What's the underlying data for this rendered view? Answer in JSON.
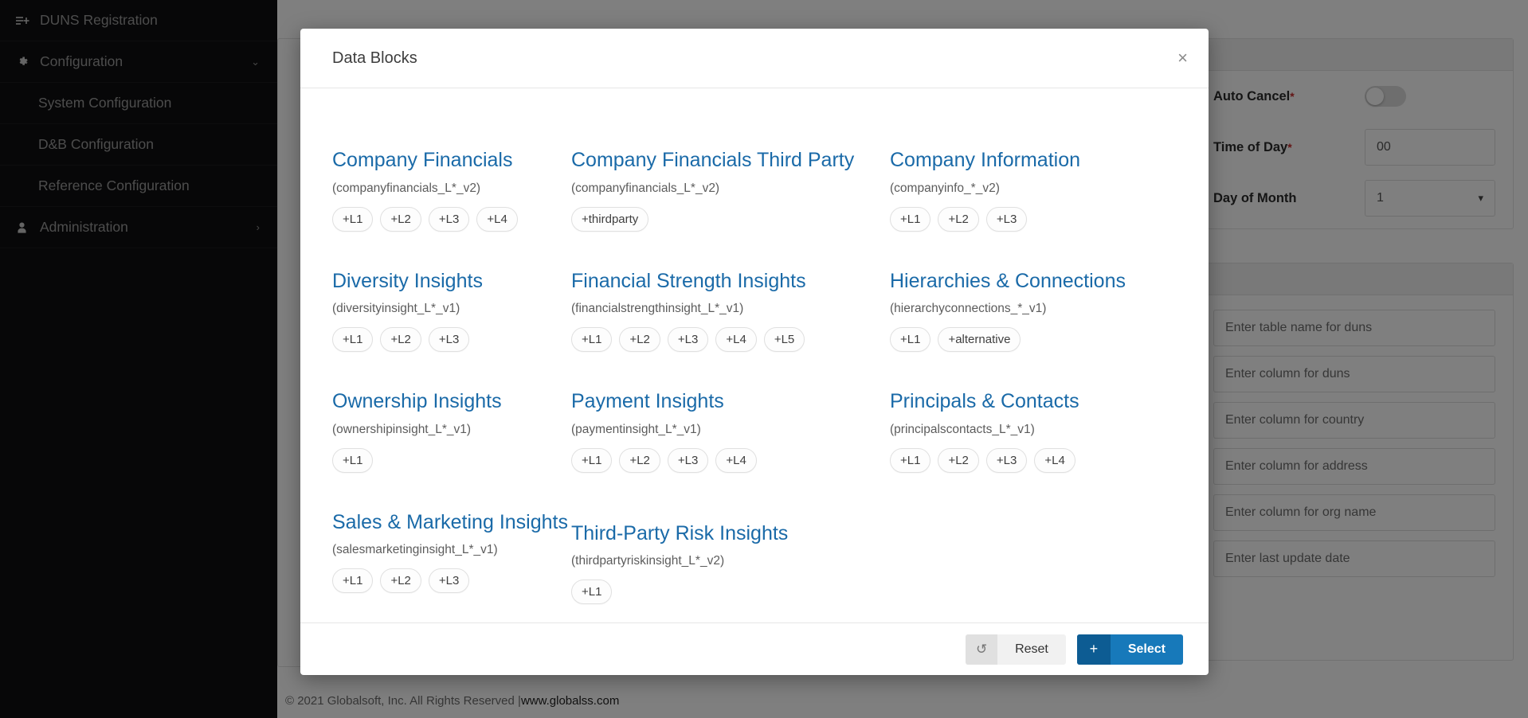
{
  "sidebar": {
    "items": [
      {
        "label": "DUNS Registration",
        "icon": "list-add-icon",
        "kind": "top",
        "chevron": ""
      },
      {
        "label": "Configuration",
        "icon": "gear-icon",
        "kind": "top",
        "chevron": "⌄"
      },
      {
        "label": "System Configuration",
        "icon": "",
        "kind": "sub",
        "chevron": ""
      },
      {
        "label": "D&B Configuration",
        "icon": "",
        "kind": "sub",
        "chevron": ""
      },
      {
        "label": "Reference Configuration",
        "icon": "",
        "kind": "sub",
        "chevron": ""
      },
      {
        "label": "Administration",
        "icon": "user-icon",
        "kind": "top",
        "chevron": "›"
      }
    ]
  },
  "modal": {
    "title": "Data Blocks",
    "close_label": "×",
    "blocks": [
      {
        "name": "Company Financials",
        "code": "(companyfinancials_L*_v2)",
        "chips": [
          "+L1",
          "+L2",
          "+L3",
          "+L4"
        ]
      },
      {
        "name": "Company Financials Third Party",
        "code": "(companyfinancials_L*_v2)",
        "chips": [
          "+thirdparty"
        ]
      },
      {
        "name": "Company Information",
        "code": "(companyinfo_*_v2)",
        "chips": [
          "+L1",
          "+L2",
          "+L3"
        ]
      },
      {
        "name": "Diversity Insights",
        "code": "(diversityinsight_L*_v1)",
        "chips": [
          "+L1",
          "+L2",
          "+L3"
        ]
      },
      {
        "name": "Financial Strength Insights",
        "code": "(financialstrengthinsight_L*_v1)",
        "chips": [
          "+L1",
          "+L2",
          "+L3",
          "+L4",
          "+L5"
        ]
      },
      {
        "name": "Hierarchies & Connections",
        "code": "(hierarchyconnections_*_v1)",
        "chips": [
          "+L1",
          "+alternative"
        ]
      },
      {
        "name": "Ownership Insights",
        "code": "(ownershipinsight_L*_v1)",
        "chips": [
          "+L1"
        ]
      },
      {
        "name": "Payment Insights",
        "code": "(paymentinsight_L*_v1)",
        "chips": [
          "+L1",
          "+L2",
          "+L3",
          "+L4"
        ]
      },
      {
        "name": "Principals & Contacts",
        "code": "(principalscontacts_L*_v1)",
        "chips": [
          "+L1",
          "+L2",
          "+L3",
          "+L4"
        ]
      },
      {
        "name": "Sales & Marketing Insights",
        "code": "(salesmarketinginsight_L*_v1)",
        "chips": [
          "+L1",
          "+L2",
          "+L3"
        ]
      },
      {
        "name": "Third-Party Risk Insights",
        "code": "(thirdpartyriskinsight_L*_v2)",
        "chips": [
          "+L1"
        ]
      }
    ],
    "footer": {
      "reset_label": "Reset",
      "reset_icon": "↺",
      "select_label": "Select",
      "select_icon": "+"
    }
  },
  "right_panel": {
    "fields": [
      {
        "label": "Auto Cancel",
        "required": true,
        "type": "toggle",
        "value": ""
      },
      {
        "label": "Time of Day",
        "required": true,
        "type": "text",
        "value": "00"
      },
      {
        "label": "Day of Month",
        "required": false,
        "type": "select",
        "value": "1"
      }
    ],
    "inputs": [
      {
        "placeholder": "Enter table name for duns",
        "value": ""
      },
      {
        "placeholder": "Enter column for duns",
        "value": ""
      },
      {
        "placeholder": "Enter column for country",
        "value": ""
      },
      {
        "placeholder": "Enter column for address",
        "value": ""
      },
      {
        "placeholder": "Enter column for org name",
        "value": ""
      },
      {
        "placeholder": "Enter last update date",
        "value": ""
      }
    ]
  },
  "page_footer": {
    "copyright": "© 2021 Globalsoft, Inc. All Rights Reserved | ",
    "site": "www.globalss.com"
  },
  "colors": {
    "link_blue": "#1a6aa8",
    "primary_button": "#1779ba",
    "sidebar_bg": "#0f0f10",
    "required_star": "#c62828"
  }
}
